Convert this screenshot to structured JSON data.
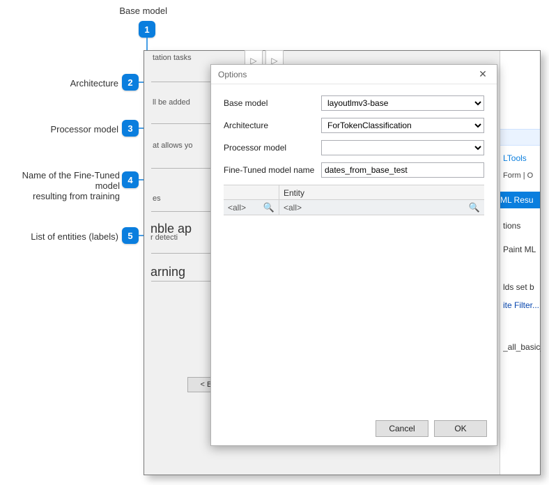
{
  "callouts": {
    "c1": "Base model",
    "c2": "Architecture",
    "c3": "Processor model",
    "c4": "Name of the Fine-Tuned model\nresulting from training",
    "c5": "List of entities (labels)"
  },
  "background": {
    "tasks": "tation tasks",
    "added": "ll be added",
    "allows": "at allows yo",
    "es": "es",
    "nble": "nble ap",
    "detect": "r detecti",
    "arning": "arning",
    "back_label": "< Ba"
  },
  "right_panel": {
    "form_tab": "Form",
    "o_tab": " O",
    "tools": "LTools",
    "ml_results": " ML Resu",
    "tions": "tions",
    "paint": " Paint ML",
    "ids": "lds set b",
    "filter": "ite Filter...",
    "basic": "_all_basic_"
  },
  "dialog": {
    "title": "Options",
    "labels": {
      "base_model": "Base model",
      "architecture": "Architecture",
      "processor_model": "Processor model",
      "fine_tuned": "Fine-Tuned model name"
    },
    "values": {
      "base_model": "layoutlmv3-base",
      "architecture": "ForTokenClassification",
      "processor_model": "",
      "fine_tuned": "dates_from_base_test"
    },
    "entity_header": "Entity",
    "filter_all": "<all>",
    "cancel": "Cancel",
    "ok": "OK"
  }
}
